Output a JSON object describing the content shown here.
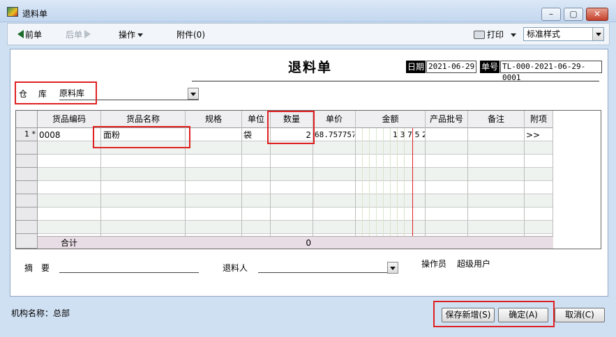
{
  "window": {
    "title": "退料单",
    "min": "–",
    "max": "▢",
    "close": "✕"
  },
  "toolbar": {
    "prev": "前单",
    "next": "后单",
    "operate": "操作",
    "attachment": "附件(0)",
    "print": "打印",
    "style_value": "标准样式"
  },
  "form": {
    "title": "退料单",
    "date_label": "日期",
    "date_value": "2021-06-29",
    "no_label": "单号",
    "no_value": "TL-000-2021-06-29-0001",
    "warehouse_label": "仓　 库",
    "warehouse_value": "原料库"
  },
  "grid": {
    "columns": [
      "货品编码",
      "货品名称",
      "规格",
      "单位",
      "数量",
      "单价",
      "金额",
      "产品批号",
      "备注",
      "附项"
    ],
    "rows": [
      {
        "row_no": "1 *",
        "code": "0008",
        "name": "面粉",
        "spec": "",
        "unit": "袋",
        "qty": "2",
        "price": "68.757757",
        "amount": "1 3 7 5 2",
        "batch": "",
        "note": "",
        "extra": ">>"
      }
    ],
    "summary": {
      "label": "合计",
      "qty": "0"
    }
  },
  "footer": {
    "remark_label": "摘　要",
    "returner_label": "退料人",
    "operator_label": "操作员",
    "operator_value": "超级用户"
  },
  "status": {
    "org_label": "机构名称：总部",
    "save_new": "保存新增(S)",
    "confirm": "确定(A)",
    "cancel": "取消(C)"
  },
  "colors": {
    "highlight": "#e02020",
    "window_bg": "#cfe0f3",
    "grid_alt_row": "#eef3f0",
    "summary_row": "#e8dde4"
  }
}
